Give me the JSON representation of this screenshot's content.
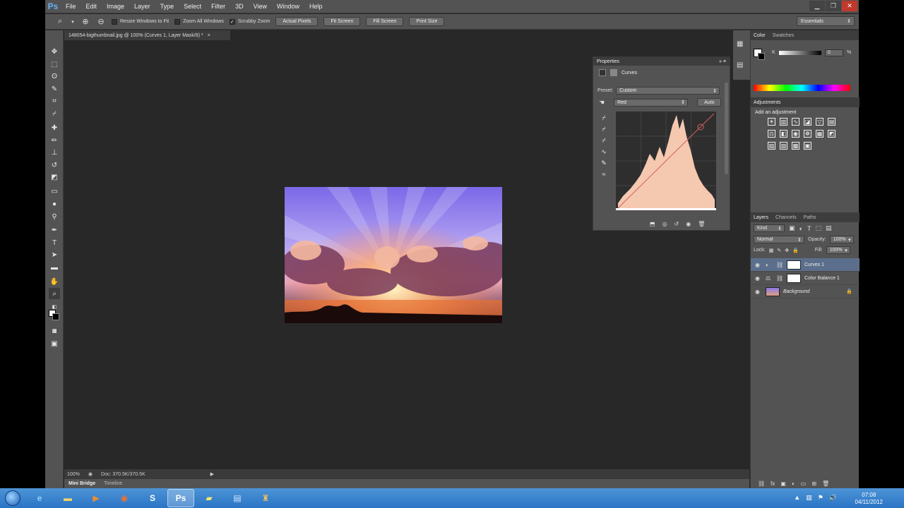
{
  "menubar": {
    "logo": "Ps",
    "items": [
      "File",
      "Edit",
      "Image",
      "Layer",
      "Type",
      "Select",
      "Filter",
      "3D",
      "View",
      "Window",
      "Help"
    ]
  },
  "options_bar": {
    "resize_windows_label": "Resize Windows to Fit",
    "zoom_all_label": "Zoom All Windows",
    "scrubby_zoom_label": "Scrubby Zoom",
    "actual_pixels_label": "Actual Pixels",
    "fit_screen_label": "Fit Screen",
    "fill_screen_label": "Fill Screen",
    "print_size_label": "Print Size",
    "workspace": "Essentials"
  },
  "document": {
    "tab_title": "148054-bigthumbnail.jpg @ 100% (Curves 1, Layer Mask/8) *",
    "close_symbol": "×",
    "zoom": "100%",
    "doc_size": "Doc: 370.5K/370.5K"
  },
  "bottom_tabs": [
    "Mini Bridge",
    "Timeline"
  ],
  "properties": {
    "title": "Properties",
    "panel_name": "Curves",
    "preset_label": "Preset:",
    "preset_value": "Custom",
    "channel_value": "Red",
    "auto_label": "Auto"
  },
  "color_panel": {
    "tabs": [
      "Color",
      "Swatches"
    ],
    "channel_label": "K",
    "value": "0",
    "unit": "%"
  },
  "adjustments": {
    "title": "Adjustments",
    "add_label": "Add an adjustment"
  },
  "layers_panel": {
    "tabs": [
      "Layers",
      "Channels",
      "Paths"
    ],
    "kind_label": "Kind",
    "blend_mode": "Normal",
    "opacity_label": "Opacity:",
    "opacity_value": "100%",
    "lock_label": "Lock:",
    "fill_label": "Fill:",
    "fill_value": "100%",
    "layers": [
      {
        "name": "Curves 1",
        "selected": true
      },
      {
        "name": "Color Balance 1",
        "selected": false
      },
      {
        "name": "Background",
        "selected": false
      }
    ]
  },
  "taskbar": {
    "time": "07:08",
    "date": "04/11/2012"
  }
}
